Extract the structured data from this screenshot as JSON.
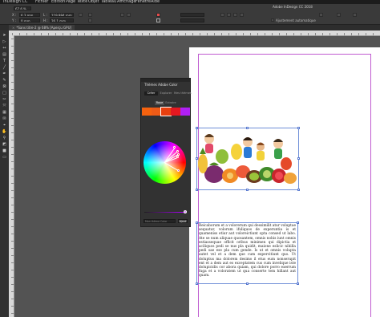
{
  "menubar": {
    "items": [
      "InDesign CC",
      "Fichier",
      "Edition",
      "Page",
      "Texte",
      "Objet",
      "Tableau",
      "Affichage",
      "Fenêtre",
      "Aide"
    ]
  },
  "app_title": "Adobe InDesign CC 2018",
  "zoom": "67,6 %",
  "control": {
    "x_label": "X :",
    "x_value": "6,3 mm",
    "y_label": "Y :",
    "y_value": "0 mm",
    "w_label": "L :",
    "w_value": "119,994 mm",
    "h_label": "H :",
    "h_value": "26,1 mm",
    "autofit_label": "Ajustement automatique"
  },
  "document_tab": {
    "label": "*Sans titre-2 @ 68% [Aperçu GPU]",
    "close": "×"
  },
  "toolbar": {
    "tools": [
      {
        "name": "selection-tool",
        "glyph": "➤"
      },
      {
        "name": "direct-selection-tool",
        "glyph": "▷"
      },
      {
        "name": "gap-tool",
        "glyph": "↔"
      },
      {
        "name": "content-collector-tool",
        "glyph": "▤"
      },
      {
        "name": "type-tool",
        "glyph": "T"
      },
      {
        "name": "line-tool",
        "glyph": "╱"
      },
      {
        "name": "pen-tool",
        "glyph": "✒"
      },
      {
        "name": "pencil-tool",
        "glyph": "✎"
      },
      {
        "name": "rectangle-frame-tool",
        "glyph": "⊠"
      },
      {
        "name": "rectangle-tool",
        "glyph": "□"
      },
      {
        "name": "scissors-tool",
        "glyph": "✂"
      },
      {
        "name": "free-transform-tool",
        "glyph": "⤧"
      },
      {
        "name": "gradient-tool",
        "glyph": "▦"
      },
      {
        "name": "note-tool",
        "glyph": "✉"
      },
      {
        "name": "eyedropper-tool",
        "glyph": "⌖"
      },
      {
        "name": "hand-tool",
        "glyph": "✋"
      },
      {
        "name": "zoom-tool",
        "glyph": "⚲"
      },
      {
        "name": "fill-stroke-swatch",
        "glyph": "◩"
      },
      {
        "name": "apply-color",
        "glyph": "■"
      },
      {
        "name": "view-mode",
        "glyph": "▭"
      }
    ]
  },
  "panel": {
    "title": "Thèmes Adobe Color",
    "tabs": [
      "Créer",
      "Explorer",
      "Mes thèmes"
    ],
    "subtabs": [
      "Roue",
      "Extraire"
    ],
    "swatches": [
      "#f5620f",
      "#ee5b17",
      "#e8400f",
      "#e51820",
      "#b020f5"
    ],
    "harmony_dots": [
      "#f5620f",
      "#ee5b17",
      "#e8400f",
      "#e51820",
      "#b020f5"
    ],
    "name_placeholder": "Mon thème Color",
    "add_button": "Ajout"
  },
  "document": {
    "body_text": "Reicaborum et a volorerum qui dessimilit atur voluptae sequatur, volorum ifuliquos de experuntia is et quameniss etiur aut voloreictiunt opta consed ut labo. Ate se num aliquae quosantem, omnis nobis iunt omnis estiassequae officit oribus minimen qui dipictia et aciliquos pedi se nus pla quidit, maione eslicic nihilla pedi sae ese pla cum gende. Is ut et omnis volupta autet vel et a dem que cum expercitiunt quo. Ut doluptus ma dolorem desimo il etus eum nonserupit ent et a dem aut es exceptatem cus cum invelique iste dolupicidis cor abora quiam, qui dolore porro exerrum fuga et a voloratem ut qua conserte tem hillant aut quam."
  }
}
